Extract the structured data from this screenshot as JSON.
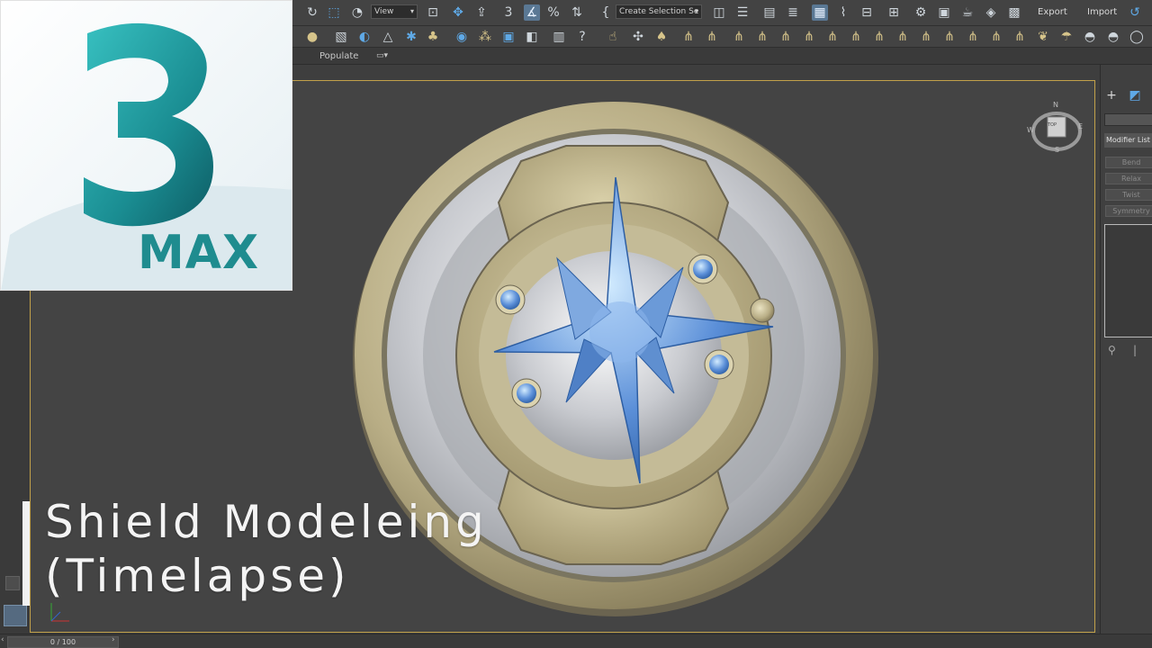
{
  "toolbar": {
    "view_dropdown": "View",
    "selection_set_dropdown": "Create Selection Se",
    "export_label": "Export",
    "import_label": "Import"
  },
  "ribbon": {
    "populate_label": "Populate"
  },
  "command_panel": {
    "modifier_list_label": "Modifier List",
    "modifiers": [
      "Bend",
      "Relax",
      "Twist",
      "Symmetry"
    ]
  },
  "timeline": {
    "frame_display": "0 / 100"
  },
  "viewcube": {
    "face_label": "TOP",
    "compass": [
      "N",
      "E",
      "S",
      "W"
    ]
  },
  "logo": {
    "number": "3",
    "product": "MAX"
  },
  "video_title": {
    "line1": "Shield Modeleing",
    "line2": "(Timelapse)"
  },
  "colors": {
    "accent_blue": "#5fa9e6",
    "viewport_border": "#c2a14a",
    "logo_teal": "#1f8c8f",
    "gem_blue": "#5b8fd8"
  }
}
